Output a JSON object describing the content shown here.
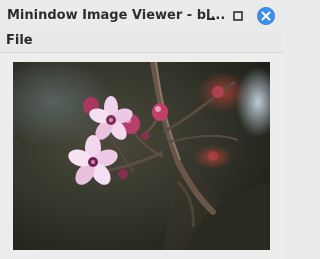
{
  "window": {
    "title": "Minindow Image Viewer - bl...",
    "controls": {
      "minimize_icon": "minimize-icon",
      "maximize_icon": "maximize-icon",
      "close_icon": "close-icon",
      "close_color": "#3d8ee6"
    }
  },
  "menu": {
    "items": [
      {
        "label": "File"
      }
    ]
  },
  "image": {
    "description_icon": "photo-blossom-branch",
    "background_color": "#2a2a20"
  }
}
